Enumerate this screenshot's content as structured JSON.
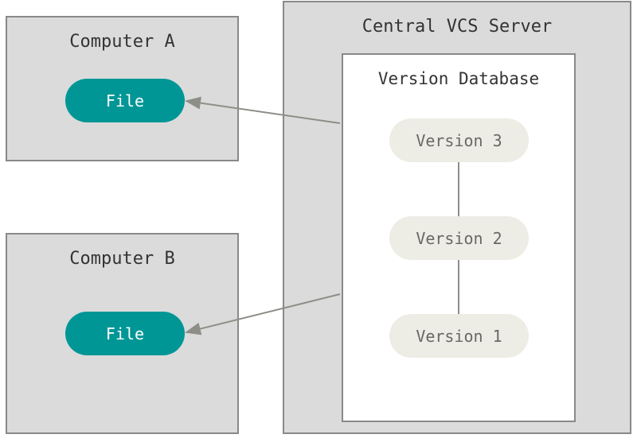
{
  "computerA": {
    "title": "Computer A",
    "file": "File"
  },
  "computerB": {
    "title": "Computer B",
    "file": "File"
  },
  "server": {
    "title": "Central VCS Server",
    "database": {
      "title": "Version Database",
      "versions": [
        "Version 3",
        "Version 2",
        "Version 1"
      ]
    }
  }
}
